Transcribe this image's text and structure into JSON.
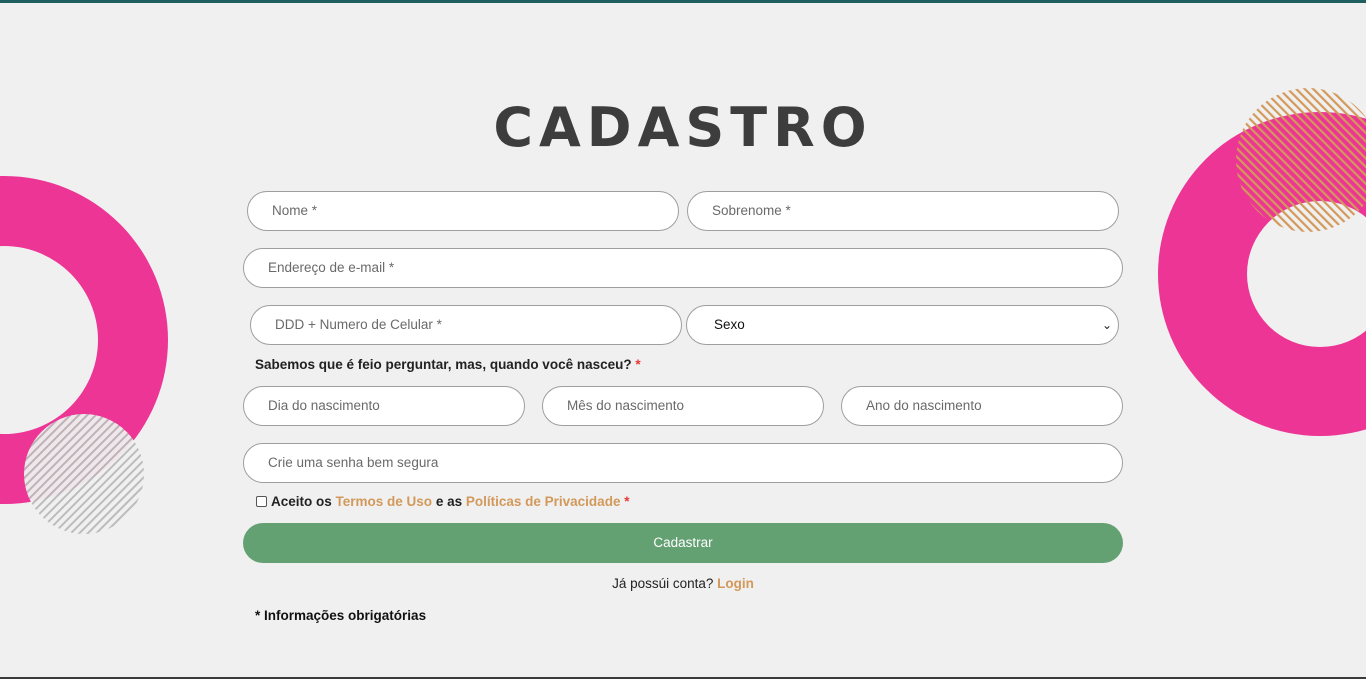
{
  "page": {
    "title": "CADASTRO"
  },
  "form": {
    "first_name_placeholder": "Nome *",
    "last_name_placeholder": "Sobrenome *",
    "email_placeholder": "Endereço de e-mail *",
    "phone_placeholder": "DDD + Numero de Celular *",
    "gender_selected": "Sexo",
    "birth_question": "Sabemos que é feio perguntar, mas, quando você nasceu?",
    "required_mark": "*",
    "day_placeholder": "Dia do nascimento",
    "month_placeholder": "Mês do nascimento",
    "year_placeholder": "Ano do nascimento",
    "password_placeholder": "Crie uma senha bem segura",
    "terms_prefix": "Aceito os",
    "terms_link": "Termos de Uso",
    "terms_middle": "e as",
    "privacy_link": "Políticas de Privacidade",
    "submit_label": "Cadastrar",
    "has_account_text": "Já possúi conta?",
    "login_link": "Login",
    "required_note": "Informações obrigatórias"
  },
  "colors": {
    "background": "#f0f0f0",
    "pink": "#ec3594",
    "tan": "#d2995a",
    "green": "#63a072",
    "required": "#e53935"
  }
}
